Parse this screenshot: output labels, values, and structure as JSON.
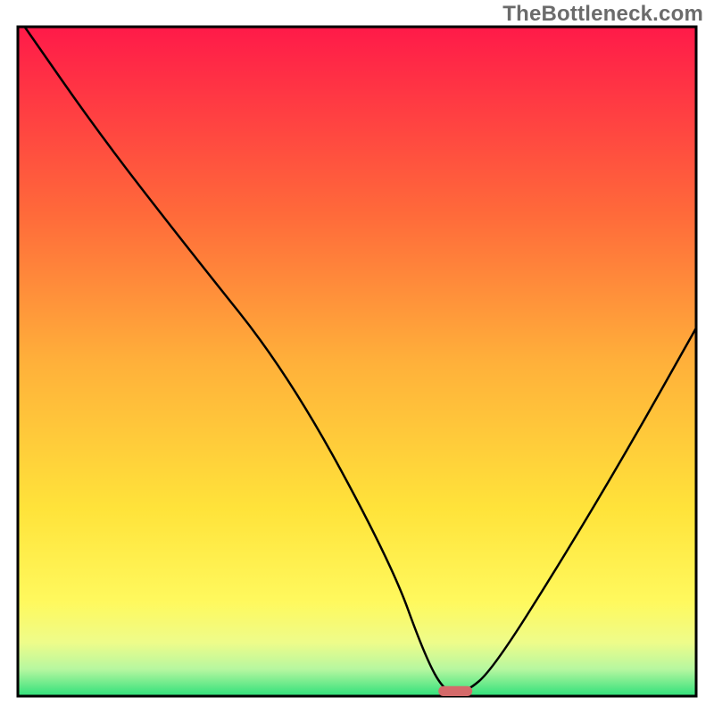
{
  "watermark": "TheBottleneck.com",
  "chart_data": {
    "type": "line",
    "title": "",
    "xlabel": "",
    "ylabel": "",
    "xlim": [
      0,
      100
    ],
    "ylim": [
      0,
      100
    ],
    "grid": false,
    "legend": false,
    "series": [
      {
        "name": "bottleneck-curve",
        "x": [
          1,
          12,
          25,
          40,
          55,
          60,
          63,
          66,
          70,
          80,
          90,
          100
        ],
        "values": [
          100,
          84,
          67,
          48,
          20,
          6,
          0.5,
          0.5,
          4,
          20,
          37,
          55
        ]
      }
    ],
    "marker": {
      "x": 64.5,
      "y": 0,
      "width": 5,
      "height": 1.5,
      "color": "#d46a6a"
    },
    "gradient_stops": [
      {
        "offset": 0,
        "color": "#ff1a49"
      },
      {
        "offset": 0.28,
        "color": "#ff6a3a"
      },
      {
        "offset": 0.5,
        "color": "#ffb03a"
      },
      {
        "offset": 0.72,
        "color": "#ffe33a"
      },
      {
        "offset": 0.86,
        "color": "#fff95e"
      },
      {
        "offset": 0.92,
        "color": "#eefc8a"
      },
      {
        "offset": 0.96,
        "color": "#b6f7a0"
      },
      {
        "offset": 1.0,
        "color": "#2fe07a"
      }
    ],
    "frame_color": "#000000",
    "line_color": "#000000"
  }
}
